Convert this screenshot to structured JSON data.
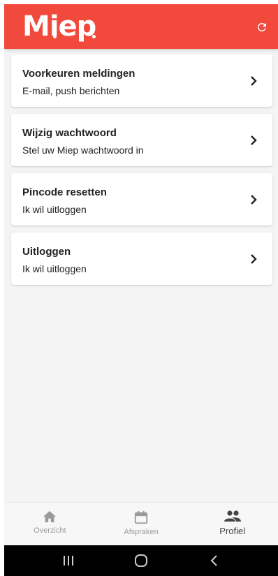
{
  "header": {
    "logo": "Miep"
  },
  "menu": [
    {
      "title": "Voorkeuren meldingen",
      "subtitle": "E-mail, push berichten"
    },
    {
      "title": "Wijzig wachtwoord",
      "subtitle": "Stel uw Miep wachtwoord in"
    },
    {
      "title": "Pincode resetten",
      "subtitle": "Ik wil uitloggen"
    },
    {
      "title": "Uitloggen",
      "subtitle": "Ik wil uitloggen"
    }
  ],
  "bottom_nav": [
    {
      "label": "Overzicht",
      "icon": "home-icon"
    },
    {
      "label": "Afspraken",
      "icon": "calendar-icon"
    },
    {
      "label": "Profiel",
      "icon": "people-icon",
      "active": true
    }
  ],
  "colors": {
    "brand": "#f14a3c",
    "background": "#f4f4f4",
    "nav_inactive": "#9a9a9a",
    "nav_active": "#444444"
  },
  "system_nav": [
    "recents-icon",
    "home-button-icon",
    "back-icon"
  ]
}
